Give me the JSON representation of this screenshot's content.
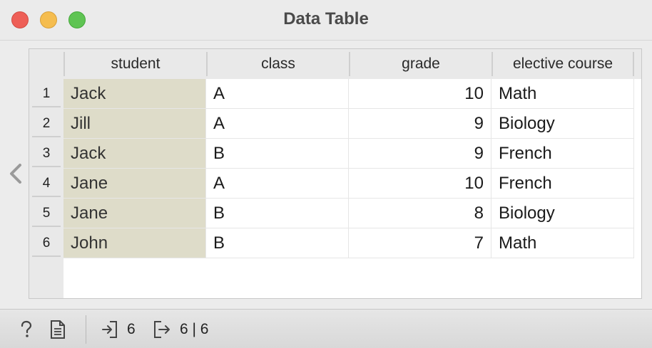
{
  "window": {
    "title": "Data Table"
  },
  "table": {
    "columns": [
      "student",
      "class",
      "grade",
      "elective course"
    ],
    "rows": [
      {
        "index": "1",
        "student": "Jack",
        "class": "A",
        "grade": "10",
        "elective": "Math"
      },
      {
        "index": "2",
        "student": "Jill",
        "class": "A",
        "grade": "9",
        "elective": "Biology"
      },
      {
        "index": "3",
        "student": "Jack",
        "class": "B",
        "grade": "9",
        "elective": "French"
      },
      {
        "index": "4",
        "student": "Jane",
        "class": "A",
        "grade": "10",
        "elective": "French"
      },
      {
        "index": "5",
        "student": "Jane",
        "class": "B",
        "grade": "8",
        "elective": "Biology"
      },
      {
        "index": "6",
        "student": "John",
        "class": "B",
        "grade": "7",
        "elective": "Math"
      }
    ]
  },
  "statusbar": {
    "input_count": "6",
    "output_count": "6 | 6"
  },
  "colors": {
    "meta_cell": "#dedcc9",
    "close": "#ee5f57",
    "minimize": "#f5bd4f",
    "maximize": "#5fc453"
  },
  "icons": [
    "help-icon",
    "report-icon",
    "input-icon",
    "output-icon",
    "collapse-left-icon"
  ]
}
